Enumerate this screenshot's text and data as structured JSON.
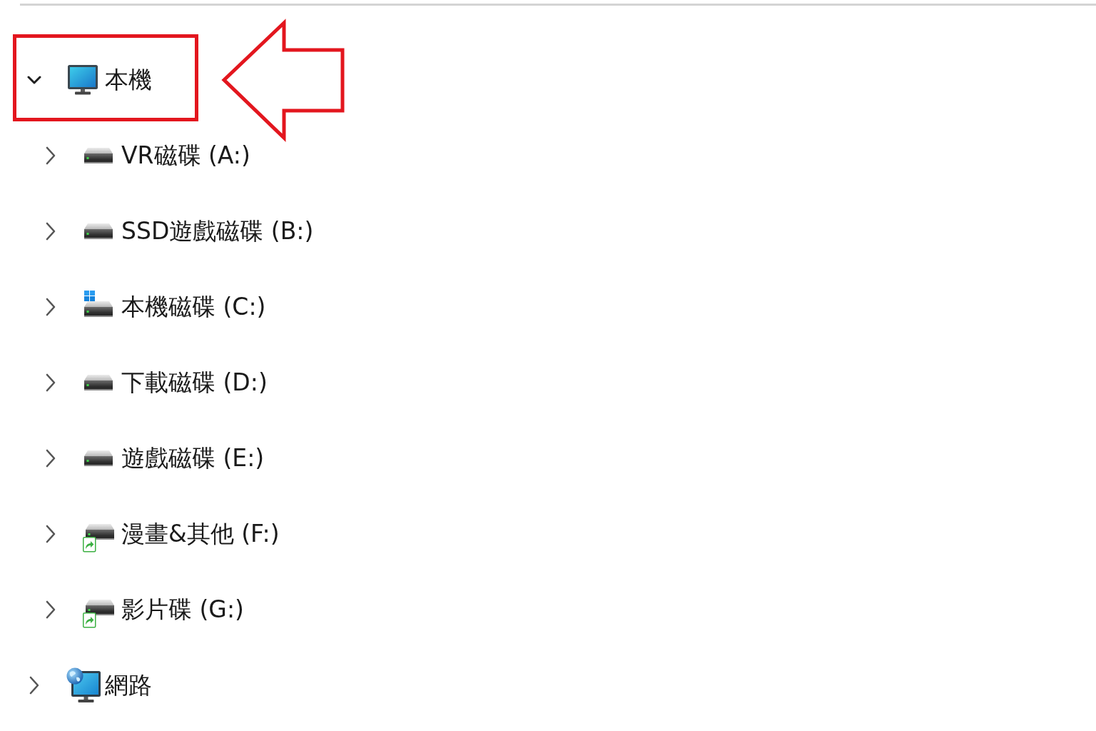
{
  "tree": [
    {
      "label": "本機",
      "kind": "computer",
      "expanded": true,
      "highlighted": true,
      "children": [
        {
          "label": "VR磁碟 (A:)",
          "kind": "drive",
          "expanded": false,
          "highlighted": false
        },
        {
          "label": "SSD遊戲磁碟 (B:)",
          "kind": "drive",
          "expanded": false,
          "highlighted": false
        },
        {
          "label": "本機磁碟 (C:)",
          "kind": "system_drive",
          "expanded": false,
          "highlighted": false
        },
        {
          "label": "下載磁碟 (D:)",
          "kind": "drive",
          "expanded": false,
          "highlighted": false
        },
        {
          "label": "遊戲磁碟 (E:)",
          "kind": "drive",
          "expanded": false,
          "highlighted": false
        },
        {
          "label": "漫畫&其他 (F:)",
          "kind": "shared_drive",
          "expanded": false,
          "highlighted": false
        },
        {
          "label": "影片碟 (G:)",
          "kind": "shared_drive",
          "expanded": false,
          "highlighted": false
        }
      ]
    },
    {
      "label": "網路",
      "kind": "network",
      "expanded": false,
      "highlighted": false
    }
  ]
}
